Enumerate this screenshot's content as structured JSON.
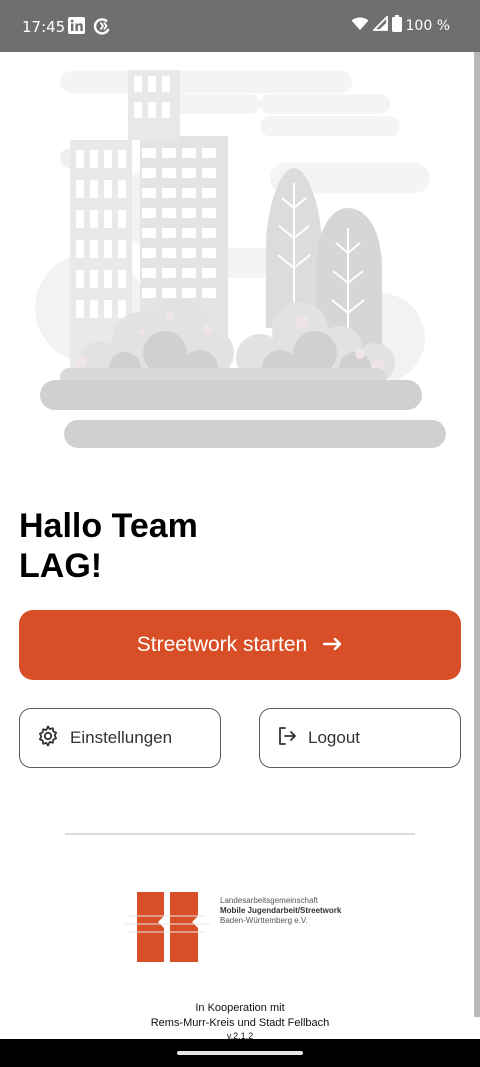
{
  "status_bar": {
    "time": "17:45",
    "app_icons": [
      "linkedin-icon",
      "sync-icon"
    ],
    "indicators": [
      "wifi-icon",
      "cellular-signal-icon",
      "battery-icon"
    ],
    "battery": "100 %"
  },
  "greeting": {
    "line1": "Hallo Team",
    "line2": "LAG!"
  },
  "primary_action": {
    "label": "Streetwork starten",
    "icon": "arrow-right-icon",
    "color": "#d84e26"
  },
  "settings_button": {
    "label": "Einstellungen",
    "icon": "gear-icon"
  },
  "logout_button": {
    "label": "Logout",
    "icon": "logout-icon"
  },
  "logo": {
    "line1": "Landesarbeitsgemeinschaft",
    "line2": "Mobile Jugendarbeit/Streetwork",
    "line3": "Baden-Württemberg e.V.",
    "color": "#d84e26"
  },
  "footer": {
    "line1": "In Kooperation mit",
    "line2": "Rems-Murr-Kreis und Stadt Fellbach",
    "version": "v.2.1.2"
  }
}
